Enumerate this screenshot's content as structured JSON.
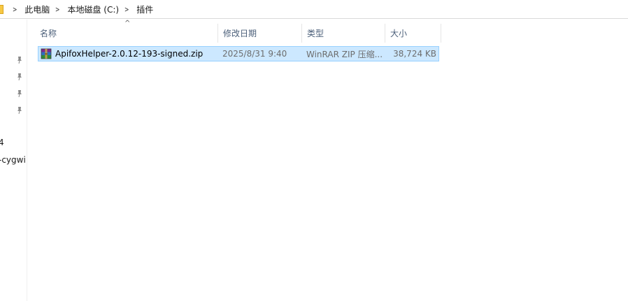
{
  "breadcrumb": [
    "此电脑",
    "本地磁盘 (C:)",
    "插件"
  ],
  "nav": {
    "text_1": "4",
    "text_2": "-cygwi"
  },
  "columns": {
    "name": "名称",
    "date": "修改日期",
    "type": "类型",
    "size": "大小",
    "sort_indicator": "^"
  },
  "files": [
    {
      "name": "ApifoxHelper-2.0.12-193-signed.zip",
      "date": "2025/8/31 9:40",
      "type": "WinRAR ZIP 压缩...",
      "size": "38,724 KB",
      "icon": "winrar-zip-icon"
    }
  ],
  "colors": {
    "selection_bg": "#cce8ff",
    "selection_border": "#99d1ff",
    "header_text": "#4c607a",
    "folder": "#f7c844"
  }
}
